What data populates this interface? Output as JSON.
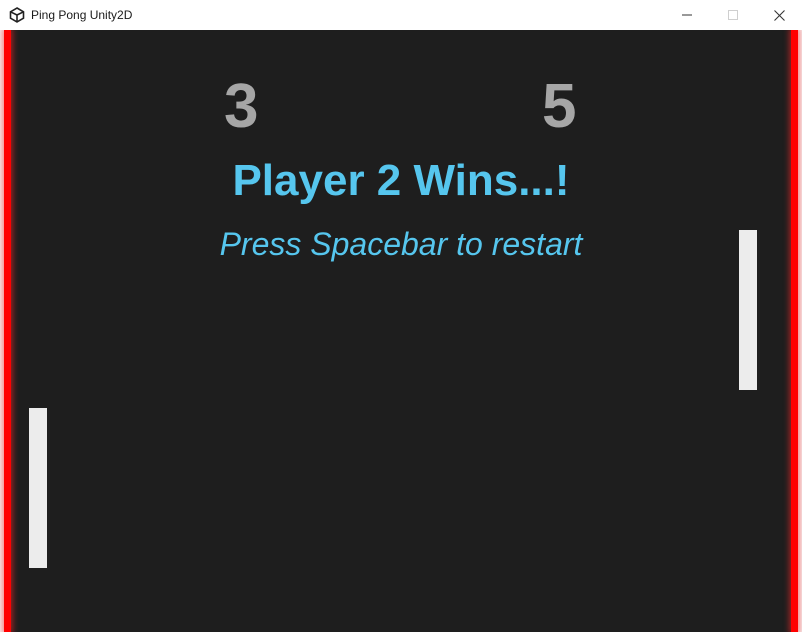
{
  "window": {
    "title": "Ping Pong Unity2D",
    "icon": "unity-logo-icon",
    "controls": {
      "minimize_icon": "minimize-icon",
      "maximize_icon": "maximize-icon",
      "close_icon": "close-icon"
    }
  },
  "game": {
    "score_left": "3",
    "score_right": "5",
    "win_message": "Player 2 Wins...!",
    "restart_prompt": "Press Spacebar to restart"
  },
  "colors": {
    "background": "#1e1e1e",
    "walls": "#ff0000",
    "paddles": "#ececec",
    "score": "#a6a6a6",
    "message": "#56c6ee",
    "midline": "#d9d9d9"
  }
}
